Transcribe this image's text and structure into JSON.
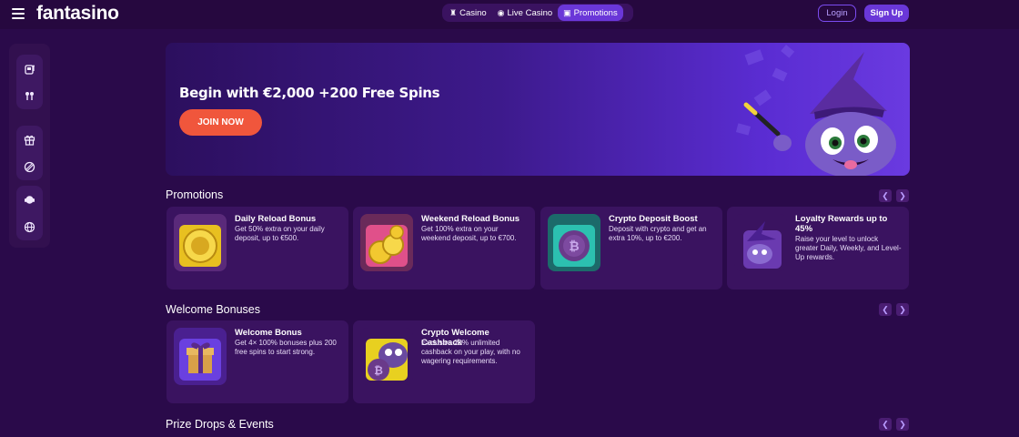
{
  "header": {
    "logo": "fantasino",
    "tabs": [
      {
        "label": "Casino",
        "icon": "slot-icon"
      },
      {
        "label": "Live Casino",
        "icon": "dealer-icon"
      },
      {
        "label": "Promotions",
        "icon": "gift-icon",
        "active": true
      }
    ],
    "login_label": "Login",
    "signup_label": "Sign Up"
  },
  "sidebar": {
    "icons": [
      "slot-machine-icon",
      "sports-icon",
      "gift-icon",
      "wheel-icon",
      "support-icon",
      "globe-icon"
    ]
  },
  "hero": {
    "title": "Begin with €2,000 +200 Free Spins",
    "cta_label": "JOIN NOW"
  },
  "sections": {
    "promotions": {
      "title": "Promotions",
      "cards": [
        {
          "title": "Daily Reload Bonus",
          "desc": "Get 50% extra on your daily deposit, up to €500."
        },
        {
          "title": "Weekend Reload Bonus",
          "desc": "Get 100% extra on your weekend deposit, up to €700."
        },
        {
          "title": "Crypto Deposit Boost",
          "desc": "Deposit with crypto and get an extra 10%, up to €200."
        },
        {
          "title": "Loyalty Rewards up to 45%",
          "desc": "Raise your level to unlock greater Daily, Weekly, and Level-Up rewards."
        }
      ]
    },
    "welcome": {
      "title": "Welcome Bonuses",
      "cards": [
        {
          "title": "Welcome Bonus",
          "desc": "Get 4× 100% bonuses plus 200 free spins to start strong."
        },
        {
          "title": "Crypto Welcome Cashback",
          "desc": "Exclusive 20% unlimited cashback on your play, with no wagering requirements."
        }
      ]
    },
    "prize": {
      "title": "Prize Drops & Events"
    }
  },
  "colors": {
    "background": "#2a0a4a",
    "accent": "#6a37d8",
    "cta": "#f0563c",
    "card": "#3a1360"
  }
}
